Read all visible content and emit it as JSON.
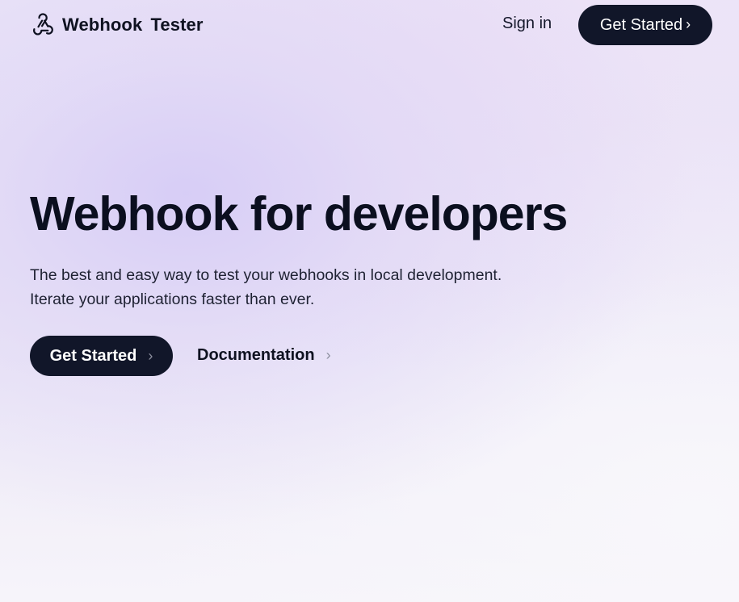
{
  "brand": {
    "name": "Webhook Tester",
    "icon": "webhook-icon"
  },
  "nav": {
    "signin_label": "Sign in",
    "get_started_label": "Get Started",
    "chevron": "›"
  },
  "hero": {
    "title": "Webhook for developers",
    "subtitle_line1": "The best and easy way to test your webhooks in local development.",
    "subtitle_line2": "Iterate your applications faster than ever.",
    "cta_label": "Get Started",
    "docs_label": "Documentation",
    "chevron": "›"
  },
  "colors": {
    "primary_button": "#111629",
    "text": "#0f1221",
    "background_accent": "#ddd6f6"
  }
}
